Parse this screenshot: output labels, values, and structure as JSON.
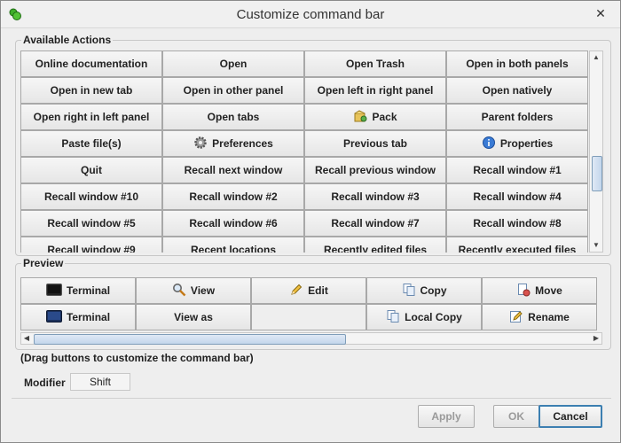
{
  "window": {
    "title": "Customize command bar",
    "close_symbol": "✕"
  },
  "available": {
    "label": "Available Actions",
    "rows": [
      [
        {
          "label": "Online documentation"
        },
        {
          "label": "Open"
        },
        {
          "label": "Open Trash"
        },
        {
          "label": "Open in both panels"
        }
      ],
      [
        {
          "label": "Open in new tab"
        },
        {
          "label": "Open in other panel"
        },
        {
          "label": "Open left in right panel"
        },
        {
          "label": "Open natively"
        }
      ],
      [
        {
          "label": "Open right in left panel"
        },
        {
          "label": "Open tabs"
        },
        {
          "label": "Pack",
          "icon": "pack-icon"
        },
        {
          "label": "Parent folders"
        }
      ],
      [
        {
          "label": "Paste file(s)"
        },
        {
          "label": "Preferences",
          "icon": "gear-icon"
        },
        {
          "label": "Previous tab"
        },
        {
          "label": "Properties",
          "icon": "info-icon"
        }
      ],
      [
        {
          "label": "Quit"
        },
        {
          "label": "Recall next window"
        },
        {
          "label": "Recall previous window"
        },
        {
          "label": "Recall window #1"
        }
      ],
      [
        {
          "label": "Recall window #10"
        },
        {
          "label": "Recall window #2"
        },
        {
          "label": "Recall window #3"
        },
        {
          "label": "Recall window #4"
        }
      ],
      [
        {
          "label": "Recall window #5"
        },
        {
          "label": "Recall window #6"
        },
        {
          "label": "Recall window #7"
        },
        {
          "label": "Recall window #8"
        }
      ],
      [
        {
          "label": "Recall window #9"
        },
        {
          "label": "Recent locations"
        },
        {
          "label": "Recently edited files"
        },
        {
          "label": "Recently executed files"
        }
      ]
    ]
  },
  "preview": {
    "label": "Preview",
    "rows": [
      [
        {
          "label": "Terminal",
          "icon": "terminal-icon"
        },
        {
          "label": "View",
          "icon": "magnifier-icon"
        },
        {
          "label": "Edit",
          "icon": "pencil-icon"
        },
        {
          "label": "Copy",
          "icon": "copy-icon"
        },
        {
          "label": "Move",
          "icon": "move-icon"
        }
      ],
      [
        {
          "label": "Terminal",
          "icon": "terminal-blue-icon"
        },
        {
          "label": "View as"
        },
        {
          "label": ""
        },
        {
          "label": "Local Copy",
          "icon": "copy-icon"
        },
        {
          "label": "Rename",
          "icon": "rename-icon"
        }
      ]
    ]
  },
  "hint": "(Drag buttons to customize the command bar)",
  "modifier": {
    "label": "Modifier",
    "value": "Shift"
  },
  "buttons": {
    "apply": "Apply",
    "ok": "OK",
    "cancel": "Cancel"
  },
  "colors": {
    "accent": "#3c7fb1"
  }
}
